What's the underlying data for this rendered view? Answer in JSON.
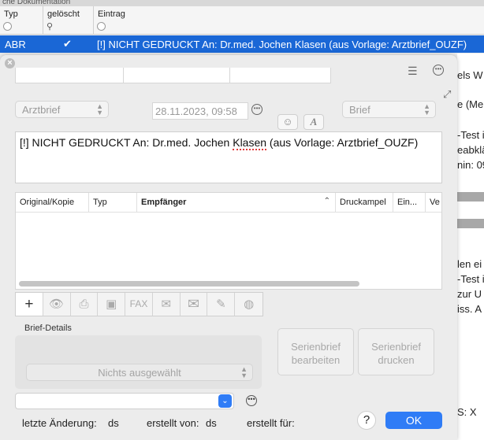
{
  "background": {
    "title_fragment": "che Dokumentation",
    "columns": {
      "typ": "Typ",
      "geloescht": "gelöscht",
      "eintrag": "Eintrag"
    },
    "row": {
      "typ": "ABR",
      "eintrag": "[!] NICHT GEDRUCKT An:  Dr.med. Jochen Klasen (aus Vorlage: Arztbrief_OUZF)"
    },
    "right_fragments": [
      "els W",
      "e (Me",
      "-Test i",
      "eabklä",
      "nin: 09",
      "len ei",
      "-Test i",
      "zur U",
      "iss. A",
      "S: X"
    ]
  },
  "dialog": {
    "close_glyph": "×",
    "doc_type": "Arztbrief",
    "datetime": "28.11.2023, 09:58",
    "format": "Brief",
    "subject_part1": "[!] NICHT GEDRUCKT An:  Dr.med. Jochen ",
    "subject_misspelled": "Klasen",
    "subject_part2": " (aus Vorlage: Arztbrief_OUZF)",
    "table_headers": [
      "Original/Kopie",
      "Typ",
      "Empfänger",
      "Druckampel",
      "Ein...",
      "Ve"
    ],
    "toolbar": {
      "add": "+",
      "fax": "FAX"
    },
    "brief_details_label": "Brief-Details",
    "nothing_selected": "Nichts ausgewählt",
    "serienbrief_bearbeiten": [
      "Serienbrief",
      "bearbeiten"
    ],
    "serienbrief_drucken": [
      "Serienbrief",
      "drucken"
    ],
    "footer": {
      "last_change_label": "letzte Änderung:",
      "last_change_value": "ds",
      "created_by_label": "erstellt von:",
      "created_by_value": "ds",
      "created_for_label": "erstellt für:"
    },
    "help": "?",
    "ok": "OK"
  }
}
